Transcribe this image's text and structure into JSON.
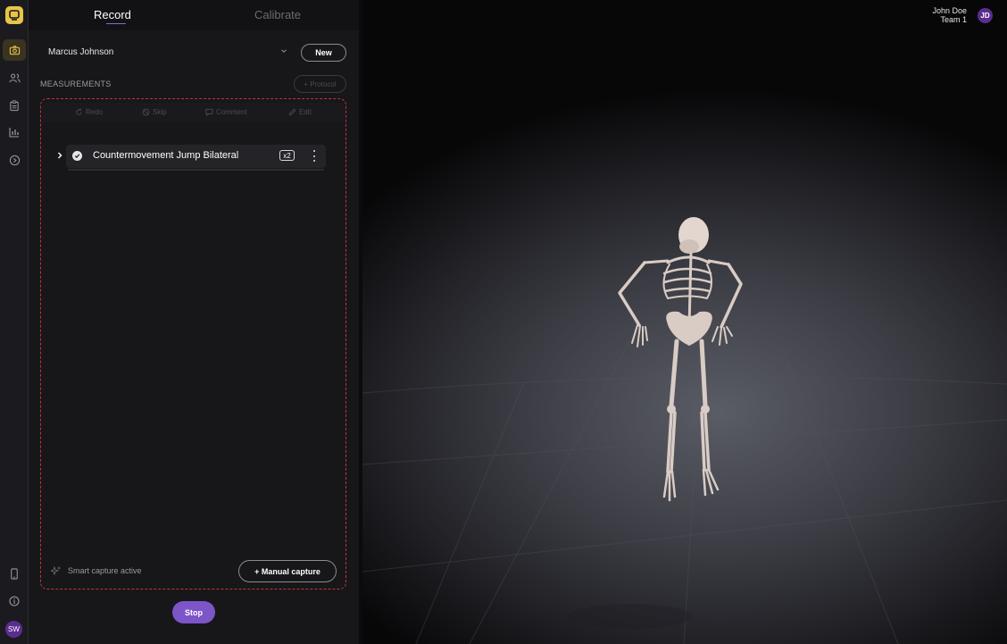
{
  "nav": {
    "logo": "app-logo",
    "items": [
      {
        "icon": "camera-icon",
        "active": true
      },
      {
        "icon": "users-icon",
        "active": false
      },
      {
        "icon": "clipboard-icon",
        "active": false
      },
      {
        "icon": "bar-chart-icon",
        "active": false
      },
      {
        "icon": "play-circle-icon",
        "active": false
      }
    ],
    "bottom": [
      {
        "icon": "phone-icon"
      },
      {
        "icon": "info-icon"
      }
    ],
    "user_initials": "SW"
  },
  "tabs": {
    "record": "Record",
    "calibrate": "Calibrate",
    "active": "record"
  },
  "athlete": {
    "name": "Marcus Johnson",
    "new_label": "New"
  },
  "measurements": {
    "title": "MEASUREMENTS",
    "protocol_label": "+ Protocol",
    "toolbar": {
      "redo": "Redo",
      "skip": "Skip",
      "comment": "Comment",
      "edit": "Edit"
    },
    "items": [
      {
        "label": "Countermovement Jump Bilateral",
        "count": "x2",
        "completed": true
      }
    ],
    "smart_capture": "Smart capture active",
    "manual_capture": "+ Manual capture"
  },
  "stop_label": "Stop",
  "user": {
    "name": "John Doe",
    "team": "Team 1",
    "initials": "JD"
  },
  "colors": {
    "accent": "#7c55c9",
    "brand": "#e8c547",
    "dashed_border": "#c4313a",
    "avatar": "#5b2d8e"
  }
}
